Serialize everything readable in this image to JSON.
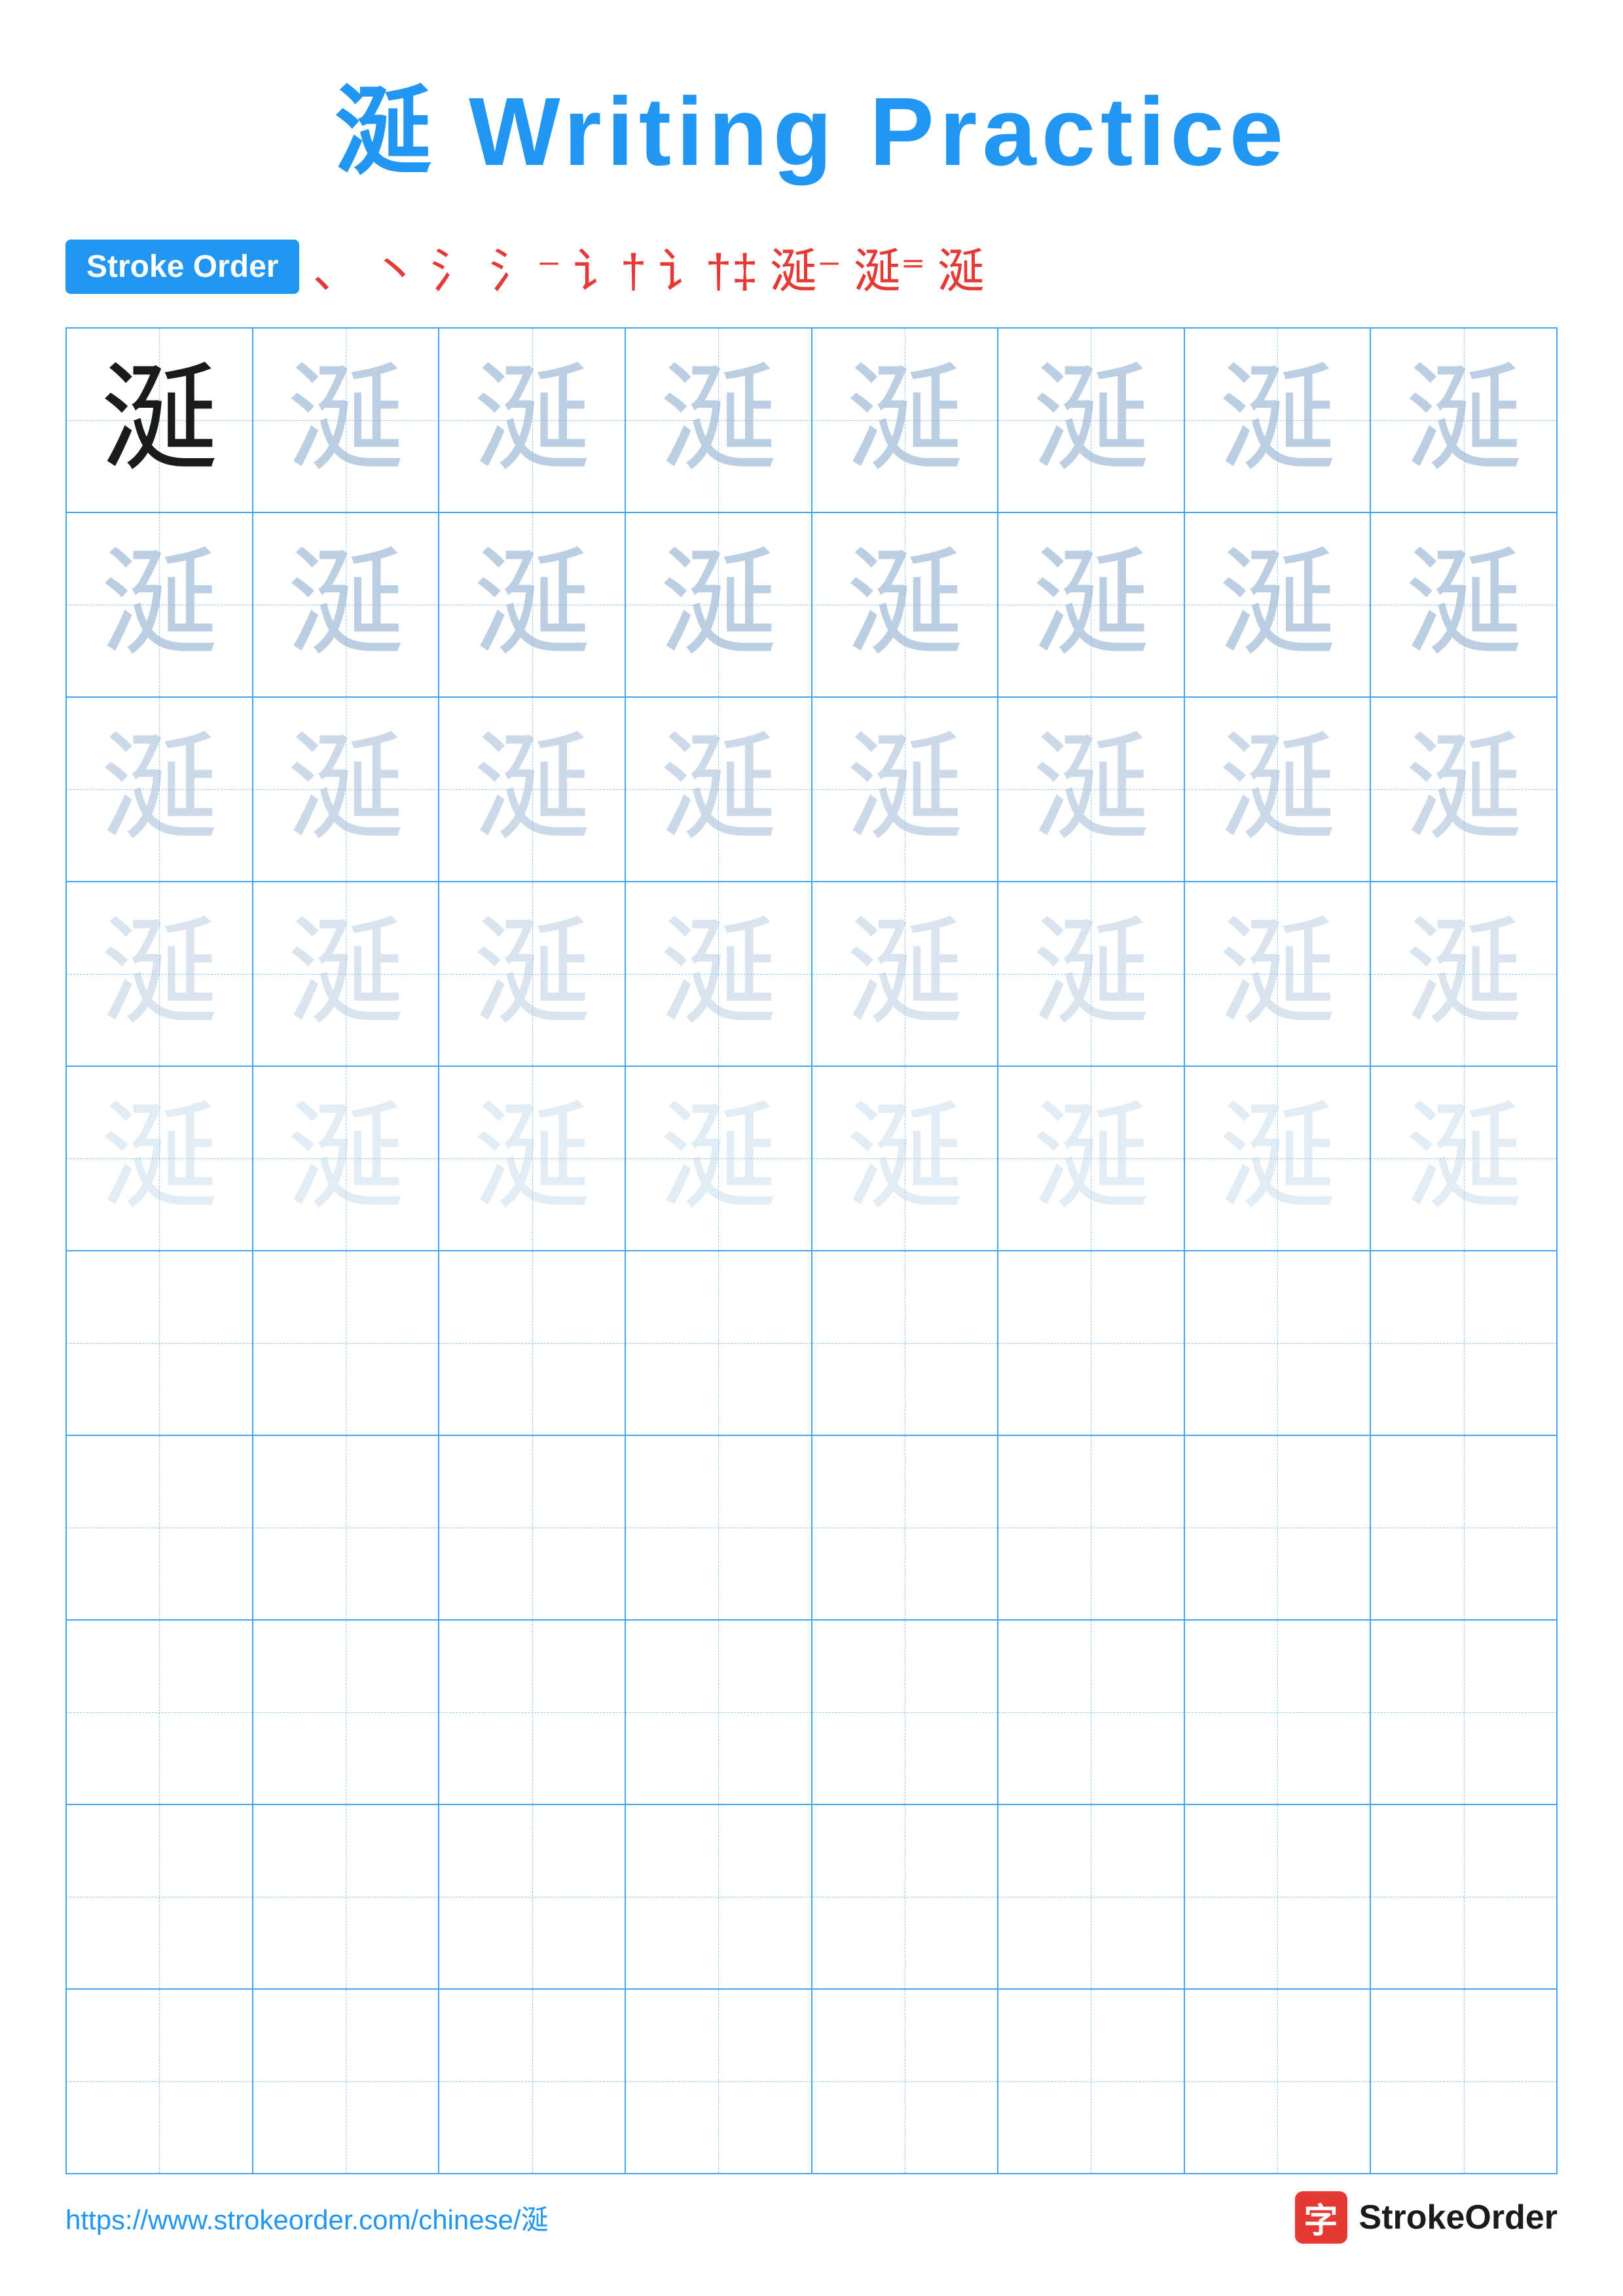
{
  "title": {
    "character": "涎",
    "text": "涎 Writing Practice",
    "blue_char": "涎"
  },
  "stroke_order": {
    "badge_label": "Stroke Order",
    "strokes": [
      "、",
      "、",
      "氵",
      "氵⁻",
      "讠†",
      "讠†‡",
      "涎⁻",
      "涎⁼",
      "涎"
    ]
  },
  "character": "涎",
  "rows": [
    {
      "type": "practice",
      "opacity_class": [
        "dark",
        "light1",
        "light1",
        "light1",
        "light1",
        "light1",
        "light1",
        "light1"
      ]
    },
    {
      "type": "practice",
      "opacity_class": [
        "light1",
        "light1",
        "light1",
        "light1",
        "light1",
        "light1",
        "light1",
        "light1"
      ]
    },
    {
      "type": "practice",
      "opacity_class": [
        "light2",
        "light2",
        "light2",
        "light2",
        "light2",
        "light2",
        "light2",
        "light2"
      ]
    },
    {
      "type": "practice",
      "opacity_class": [
        "light3",
        "light3",
        "light3",
        "light3",
        "light3",
        "light3",
        "light3",
        "light3"
      ]
    },
    {
      "type": "practice",
      "opacity_class": [
        "light4",
        "light4",
        "light4",
        "light4",
        "light4",
        "light4",
        "light4",
        "light4"
      ]
    },
    {
      "type": "empty"
    },
    {
      "type": "empty"
    },
    {
      "type": "empty"
    },
    {
      "type": "empty"
    },
    {
      "type": "empty"
    }
  ],
  "footer": {
    "url": "https://www.strokeorder.com/chinese/涎",
    "logo_char": "字",
    "logo_text": "StrokeOrder"
  }
}
